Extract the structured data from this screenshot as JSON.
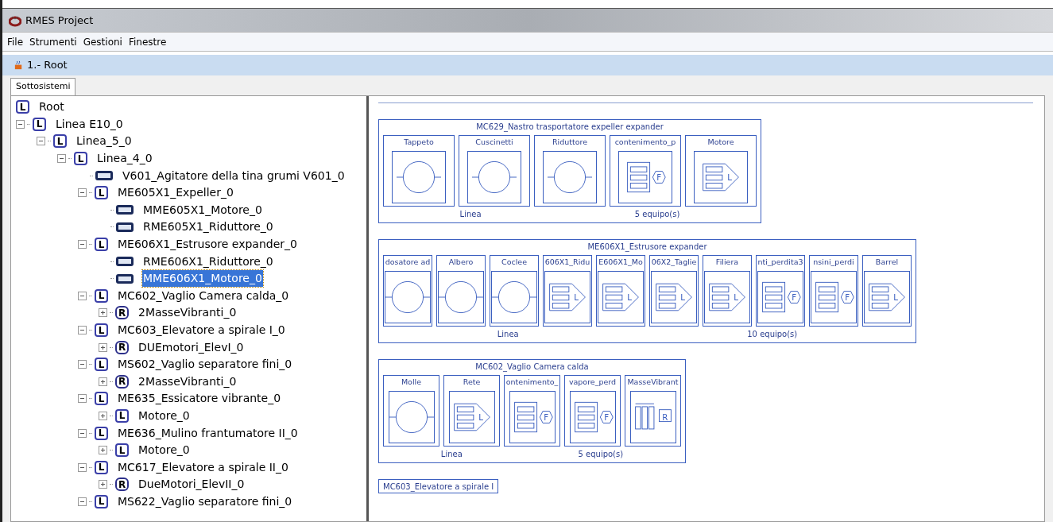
{
  "window": {
    "title": "RMES Project"
  },
  "menu": [
    "File",
    "Strumenti",
    "Gestioni",
    "Finestre"
  ],
  "frame": {
    "title": "1.- Root"
  },
  "tabs": [
    {
      "label": "Sottosistemi",
      "selected": true
    }
  ],
  "tree": [
    {
      "label": "Root",
      "kind": "L",
      "badge": "L",
      "selected": false,
      "children": [
        {
          "label": "Linea E10_0",
          "kind": "L",
          "badge": "L",
          "expanded": true,
          "selected": false,
          "children": [
            {
              "label": "Linea_5_0",
              "kind": "L",
              "badge": "L",
              "expanded": true,
              "selected": false,
              "children": [
                {
                  "label": "Linea_4_0",
                  "kind": "L",
                  "badge": "L",
                  "expanded": true,
                  "selected": false,
                  "children": [
                    {
                      "label": "V601_Agitatore della tina grumi V601_0",
                      "kind": "device",
                      "selected": false
                    },
                    {
                      "label": "ME605X1_Expeller_0",
                      "kind": "L",
                      "badge": "L",
                      "expanded": true,
                      "selected": false,
                      "children": [
                        {
                          "label": "MME605X1_Motore_0",
                          "kind": "device",
                          "selected": false
                        },
                        {
                          "label": "RME605X1_Riduttore_0",
                          "kind": "device",
                          "selected": false
                        }
                      ]
                    },
                    {
                      "label": "ME606X1_Estrusore expander_0",
                      "kind": "L",
                      "badge": "L",
                      "expanded": true,
                      "selected": false,
                      "children": [
                        {
                          "label": "RME606X1_Riduttore_0",
                          "kind": "device",
                          "selected": false
                        },
                        {
                          "label": "MME606X1_Motore_0",
                          "kind": "device",
                          "selected": true
                        }
                      ]
                    },
                    {
                      "label": "MC602_Vaglio Camera calda_0",
                      "kind": "L",
                      "badge": "L",
                      "expanded": true,
                      "selected": false,
                      "children": [
                        {
                          "label": "2MasseVibranti_0",
                          "kind": "R",
                          "badge": "R",
                          "expanded": false,
                          "selected": false
                        }
                      ]
                    },
                    {
                      "label": "MC603_Elevatore a spirale I_0",
                      "kind": "L",
                      "badge": "L",
                      "expanded": true,
                      "selected": false,
                      "children": [
                        {
                          "label": "DUEmotori_ElevI_0",
                          "kind": "R",
                          "badge": "R",
                          "expanded": false,
                          "selected": false
                        }
                      ]
                    },
                    {
                      "label": "MS602_Vaglio separatore fini_0",
                      "kind": "L",
                      "badge": "L",
                      "expanded": true,
                      "selected": false,
                      "children": [
                        {
                          "label": "2MasseVibranti_0",
                          "kind": "R",
                          "badge": "R",
                          "expanded": false,
                          "selected": false
                        }
                      ]
                    },
                    {
                      "label": "ME635_Essicatore vibrante_0",
                      "kind": "L",
                      "badge": "L",
                      "expanded": true,
                      "selected": false,
                      "children": [
                        {
                          "label": "Motore_0",
                          "kind": "L",
                          "badge": "L",
                          "expanded": false,
                          "selected": false
                        }
                      ]
                    },
                    {
                      "label": "ME636_Mulino frantumatore II_0",
                      "kind": "L",
                      "badge": "L",
                      "expanded": true,
                      "selected": false,
                      "children": [
                        {
                          "label": "Motore_0",
                          "kind": "L",
                          "badge": "L",
                          "expanded": false,
                          "selected": false
                        }
                      ]
                    },
                    {
                      "label": "MC617_Elevatore a spirale II_0",
                      "kind": "L",
                      "badge": "L",
                      "expanded": true,
                      "selected": false,
                      "children": [
                        {
                          "label": "DueMotori_ElevII_0",
                          "kind": "R",
                          "badge": "R",
                          "expanded": false,
                          "selected": false
                        }
                      ]
                    },
                    {
                      "label": "MS622_Vaglio separatore fini_0",
                      "kind": "L",
                      "badge": "L",
                      "expanded": true,
                      "selected": false
                    }
                  ]
                }
              ]
            }
          ]
        }
      ]
    }
  ],
  "blocks": [
    {
      "title": "MC629_Nastro trasportatore expeller expander",
      "footer_left": "Linea",
      "footer_right": "5  equipo(s)",
      "components": [
        {
          "label": "Tappeto",
          "kind": "circle"
        },
        {
          "label": "Cuscinetti",
          "kind": "circle"
        },
        {
          "label": "Riduttore",
          "kind": "circle"
        },
        {
          "label": "contenimento_p",
          "kind": "hex",
          "badge": "F"
        },
        {
          "label": "Motore",
          "kind": "arrow",
          "badge": "L"
        }
      ]
    },
    {
      "title": "ME606X1_Estrusore expander",
      "footer_left": "Linea",
      "footer_right": "10  equipo(s)",
      "components": [
        {
          "label": "dosatore ad",
          "kind": "circle"
        },
        {
          "label": "Albero",
          "kind": "circle"
        },
        {
          "label": "Coclee",
          "kind": "circle"
        },
        {
          "label": "606X1_Ridu",
          "kind": "arrow",
          "badge": "L"
        },
        {
          "label": "E606X1_Mo",
          "kind": "arrow",
          "badge": "L"
        },
        {
          "label": "06X2_Taglie",
          "kind": "arrow",
          "badge": "L"
        },
        {
          "label": "Filiera",
          "kind": "arrow",
          "badge": "L"
        },
        {
          "label": "nti_perdita3",
          "kind": "hex",
          "badge": "F"
        },
        {
          "label": "nsini_perdi",
          "kind": "hex",
          "badge": "F"
        },
        {
          "label": "Barrel",
          "kind": "arrow",
          "badge": "L"
        }
      ]
    },
    {
      "title": "MC602_Vaglio Camera calda",
      "footer_left": "Linea",
      "footer_right": "5  equipo(s)",
      "components": [
        {
          "label": "Molle",
          "kind": "circle"
        },
        {
          "label": "Rete",
          "kind": "arrow",
          "badge": "L"
        },
        {
          "label": "ontenimento_",
          "kind": "hex",
          "badge": "F"
        },
        {
          "label": "vapore_perd",
          "kind": "hex",
          "badge": "F"
        },
        {
          "label": "MasseVibrant",
          "kind": "bars",
          "badge": "R"
        }
      ]
    },
    {
      "title": "MC603_Elevatore a spirale I"
    }
  ]
}
